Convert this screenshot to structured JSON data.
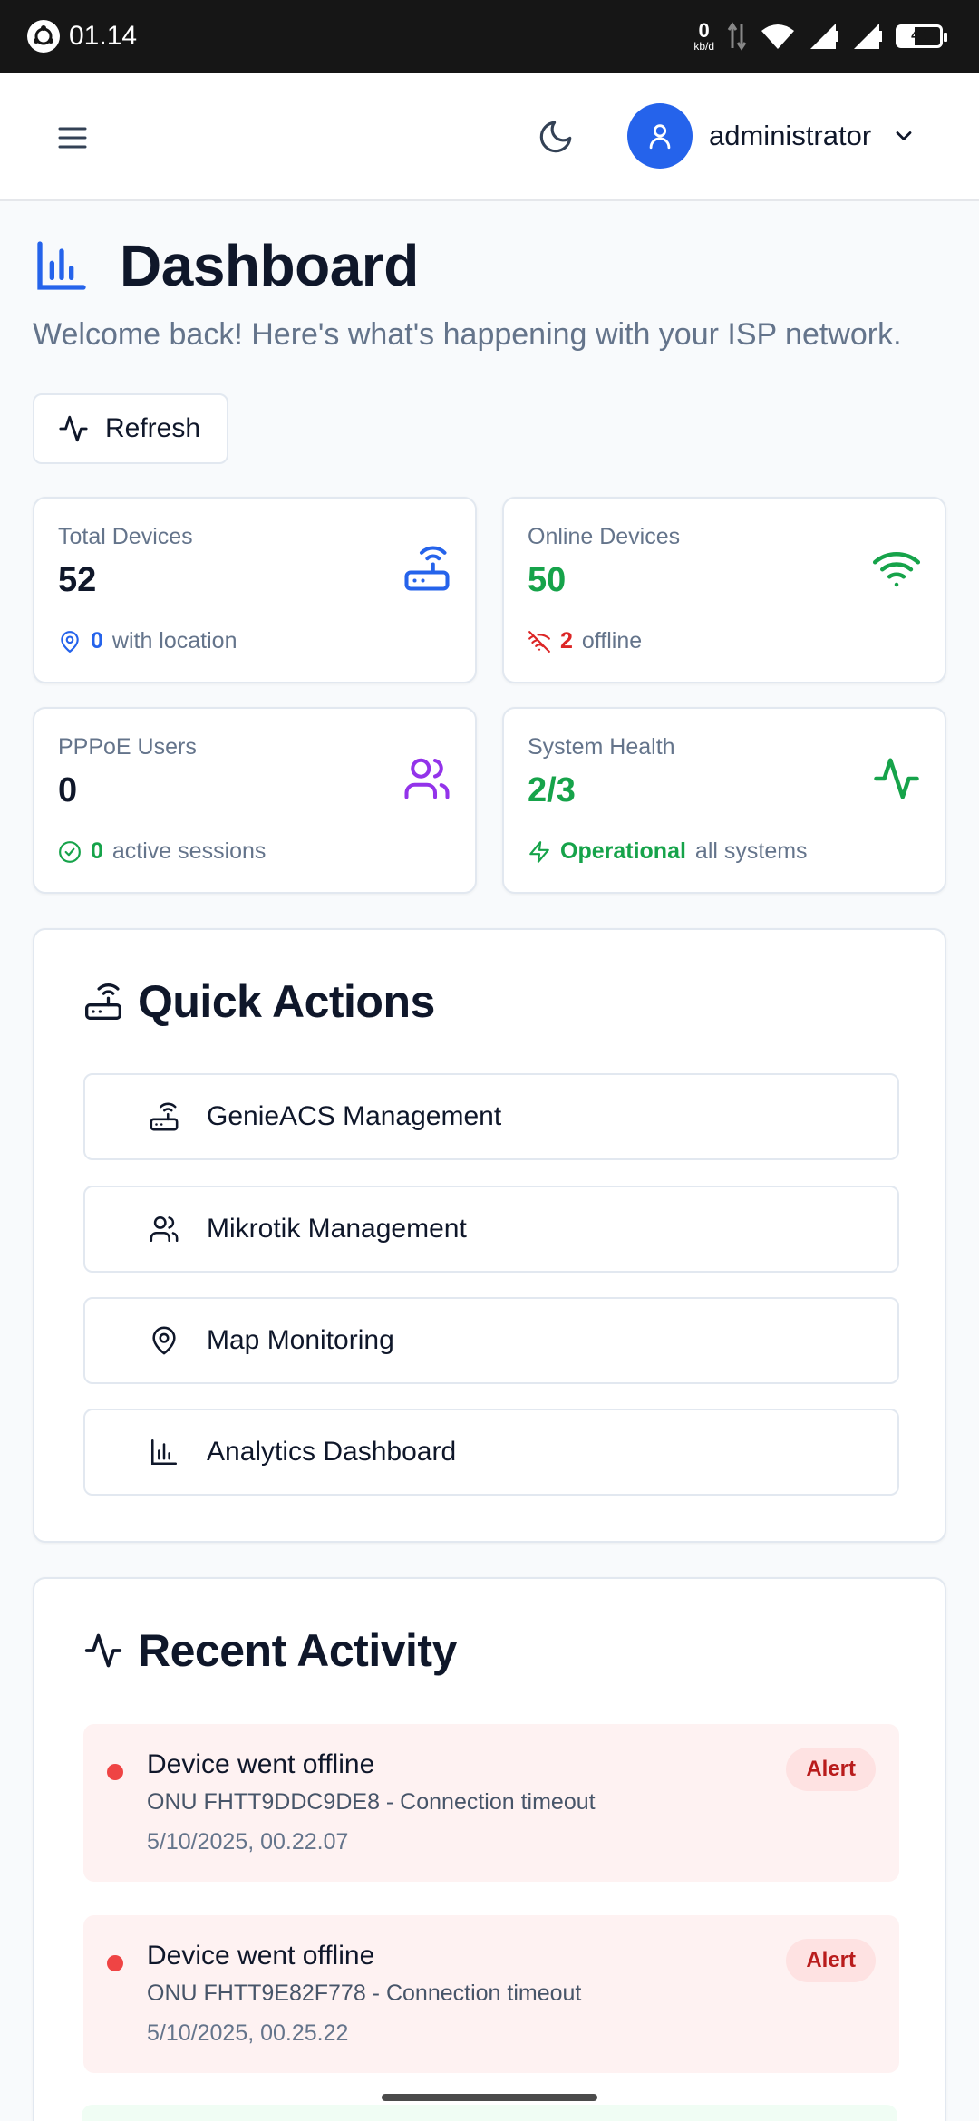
{
  "status_bar": {
    "time": "01.14",
    "net_speed": "0",
    "net_unit": "kb/d",
    "battery": "40",
    "battery_level": 0.4
  },
  "header": {
    "username": "administrator"
  },
  "page": {
    "title": "Dashboard",
    "subtitle": "Welcome back! Here's what's happening with your ISP network.",
    "refresh_label": "Refresh"
  },
  "stats": [
    {
      "label": "Total Devices",
      "value": "52",
      "sub_num": "0",
      "sub_text": "with location",
      "icon": "router-icon"
    },
    {
      "label": "Online Devices",
      "value": "50",
      "sub_num": "2",
      "sub_text": "offline",
      "icon": "wifi-icon"
    },
    {
      "label": "PPPoE Users",
      "value": "0",
      "sub_num": "0",
      "sub_text": "active sessions",
      "icon": "users-icon"
    },
    {
      "label": "System Health",
      "value": "2/3",
      "sub_num": "Operational",
      "sub_text": "all systems",
      "icon": "activity-icon"
    }
  ],
  "quick_actions": {
    "title": "Quick Actions",
    "items": [
      {
        "label": "GenieACS Management",
        "icon": "router-icon"
      },
      {
        "label": "Mikrotik Management",
        "icon": "users-icon"
      },
      {
        "label": "Map Monitoring",
        "icon": "map-pin-icon"
      },
      {
        "label": "Analytics Dashboard",
        "icon": "bar-chart-icon"
      }
    ]
  },
  "recent_activity": {
    "title": "Recent Activity",
    "items": [
      {
        "title": "Device went offline",
        "desc": "ONU FHTT9DDC9DE8 - Connection timeout",
        "time": "5/10/2025, 00.22.07",
        "badge": "Alert"
      },
      {
        "title": "Device went offline",
        "desc": "ONU FHTT9E82F778 - Connection timeout",
        "time": "5/10/2025, 00.25.22",
        "badge": "Alert"
      }
    ]
  },
  "colors": {
    "primary": "#2563eb",
    "success": "#16a34a",
    "danger": "#dc2626",
    "purple": "#9333ea",
    "muted": "#64748b"
  }
}
